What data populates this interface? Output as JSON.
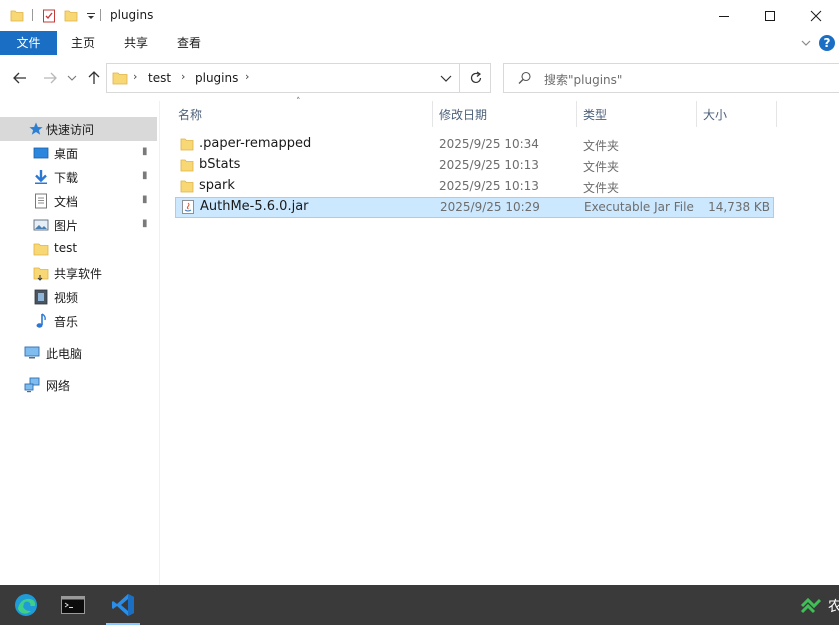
{
  "window": {
    "title": "plugins",
    "minimize_glyph": "—",
    "maximize_glyph": "☐",
    "close_glyph": "✕"
  },
  "ribbon": {
    "tabs": [
      {
        "label": "文件"
      },
      {
        "label": "主页"
      },
      {
        "label": "共享"
      },
      {
        "label": "查看"
      }
    ],
    "help_glyph": "?",
    "expand_glyph": "⌄"
  },
  "address": {
    "crumbs": [
      "test",
      "plugins"
    ],
    "separator": "›",
    "search_placeholder": "搜索\"plugins\""
  },
  "nav_pane": {
    "quick_access_label": "快速访问",
    "items": [
      {
        "label": "桌面",
        "icon": "desktop-icon",
        "pinned": true
      },
      {
        "label": "下载",
        "icon": "download-icon",
        "pinned": true
      },
      {
        "label": "文档",
        "icon": "document-icon",
        "pinned": true
      },
      {
        "label": "图片",
        "icon": "picture-icon",
        "pinned": true
      },
      {
        "label": "test",
        "icon": "folder-icon",
        "pinned": false
      },
      {
        "label": "共享软件",
        "icon": "folder-icon",
        "pinned": false
      },
      {
        "label": "视频",
        "icon": "video-icon",
        "pinned": false
      },
      {
        "label": "音乐",
        "icon": "music-icon",
        "pinned": false
      }
    ],
    "this_pc_label": "此电脑",
    "network_label": "网络",
    "pin_glyph": "📌"
  },
  "columns": {
    "name": "名称",
    "date": "修改日期",
    "type": "类型",
    "size": "大小"
  },
  "files": [
    {
      "name": ".paper-remapped",
      "date": "2025/9/25 10:34",
      "type": "文件夹",
      "size": "",
      "icon": "folder-icon",
      "selected": false
    },
    {
      "name": "bStats",
      "date": "2025/9/25 10:13",
      "type": "文件夹",
      "size": "",
      "icon": "folder-icon",
      "selected": false
    },
    {
      "name": "spark",
      "date": "2025/9/25 10:13",
      "type": "文件夹",
      "size": "",
      "icon": "folder-icon",
      "selected": false
    },
    {
      "name": "AuthMe-5.6.0.jar",
      "date": "2025/9/25 10:29",
      "type": "Executable Jar File",
      "size": "14,738 KB",
      "icon": "jar-file-icon",
      "selected": true
    }
  ],
  "taskbar": {
    "apps": [
      {
        "name": "edge-icon"
      },
      {
        "name": "terminal-icon"
      },
      {
        "name": "vscode-icon"
      }
    ],
    "tray_text": "农"
  },
  "colors": {
    "accent": "#1a6fc4",
    "selection": "#cce8ff",
    "folder": "#f8d775",
    "taskbar": "#3a3a3a"
  }
}
